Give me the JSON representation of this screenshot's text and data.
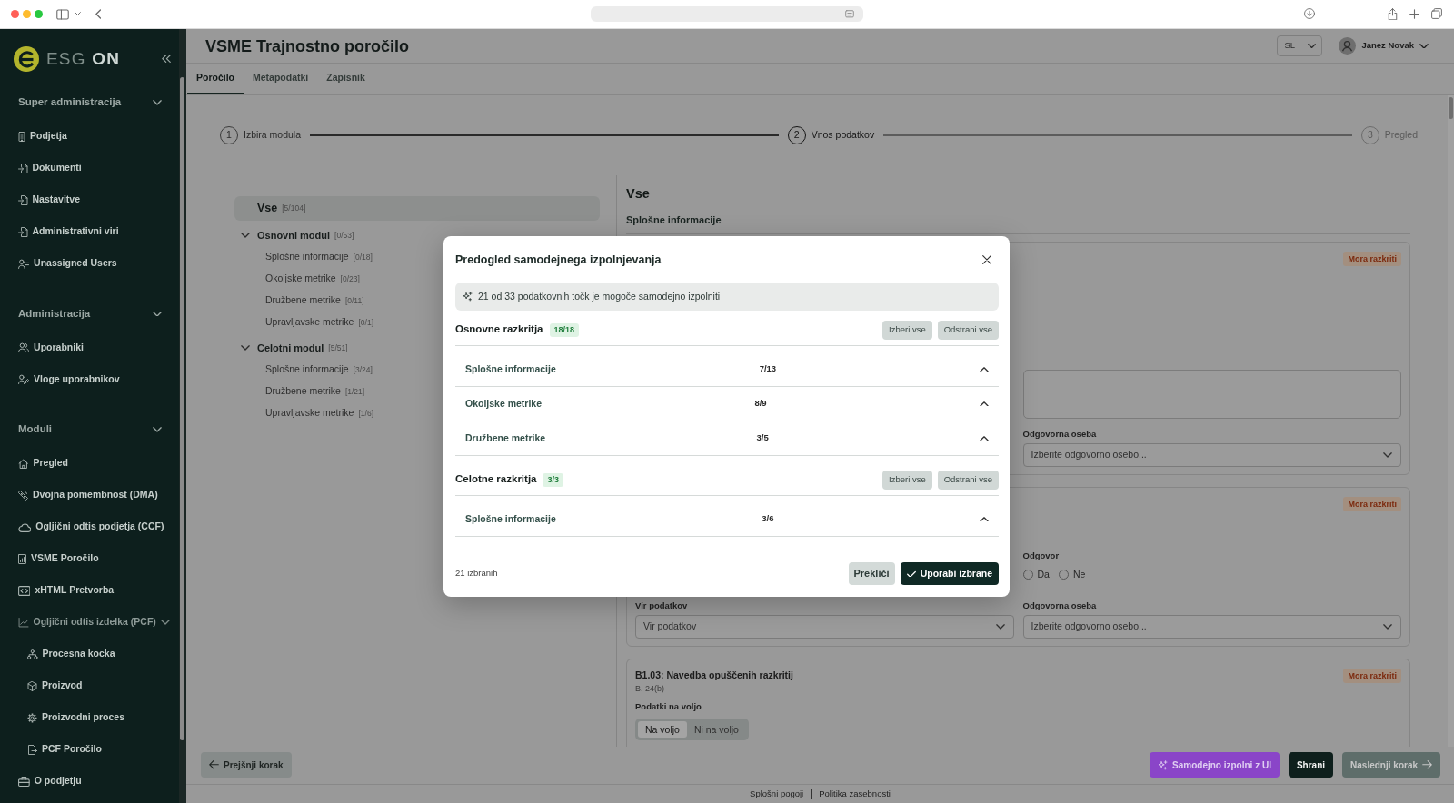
{
  "sidebar": {
    "logo": {
      "text": "ESG",
      "accent": "ON"
    },
    "sections": [
      {
        "title": "Super administracija",
        "expanded": true,
        "items": [
          {
            "label": "Podjetja"
          },
          {
            "label": "Dokumenti"
          },
          {
            "label": "Nastavitve"
          },
          {
            "label": "Administrativni viri"
          },
          {
            "label": "Unassigned Users"
          }
        ]
      },
      {
        "title": "Administracija",
        "expanded": true,
        "items": [
          {
            "label": "Uporabniki"
          },
          {
            "label": "Vloge uporabnikov"
          }
        ]
      },
      {
        "title": "Moduli",
        "expanded": true,
        "items": [
          {
            "label": "Pregled"
          },
          {
            "label": "Dvojna pomembnost (DMA)"
          },
          {
            "label": "Ogljični odtis podjetja (CCF)"
          },
          {
            "label": "VSME Poročilo"
          },
          {
            "label": "xHTML Pretvorba"
          },
          {
            "label": "Ogljični odtis izdelka (PCF)",
            "expanded": true,
            "children": [
              {
                "label": "Procesna kocka"
              },
              {
                "label": "Proizvod"
              },
              {
                "label": "Proizvodni proces"
              },
              {
                "label": "PCF Poročilo"
              }
            ]
          },
          {
            "label": "O podjetju"
          }
        ]
      }
    ]
  },
  "header": {
    "title": "VSME Trajnostno poročilo",
    "language": "SL",
    "user": "Janez Novak"
  },
  "tabs": [
    {
      "label": "Poročilo",
      "selected": true
    },
    {
      "label": "Metapodatki",
      "selected": false
    },
    {
      "label": "Zapisnik",
      "selected": false
    }
  ],
  "stepper": [
    {
      "number": "1",
      "label": "Izbira modula",
      "completed": true,
      "selected": false
    },
    {
      "number": "2",
      "label": "Vnos podatkov",
      "completed": false,
      "selected": true
    },
    {
      "number": "3",
      "label": "Pregled",
      "completed": false,
      "selected": false
    }
  ],
  "tree": [
    {
      "label": "Vse",
      "count": "[5/104]",
      "selected": true
    },
    {
      "label": "Osnovni modul",
      "count": "[0/53]",
      "selected": false,
      "expanded": true,
      "children": [
        {
          "label": "Splošne informacije",
          "count": "[0/18]",
          "selected": false
        },
        {
          "label": "Okoljske metrike",
          "count": "[0/23]",
          "selected": false
        },
        {
          "label": "Družbene metrike",
          "count": "[0/11]",
          "selected": false
        },
        {
          "label": "Upravljavske metrike",
          "count": "[0/1]",
          "selected": false
        }
      ]
    },
    {
      "label": "Celotni modul",
      "count": "[5/51]",
      "selected": false,
      "expanded": true,
      "children": [
        {
          "label": "Splošne informacije",
          "count": "[3/24]",
          "selected": false
        },
        {
          "label": "Družbene metrike",
          "count": "[1/21]",
          "selected": false
        },
        {
          "label": "Upravljavske metrike",
          "count": "[1/6]",
          "selected": false
        }
      ]
    }
  ],
  "content": {
    "title": "Vse",
    "section": "Splošne informacije",
    "cards": [
      {
        "kind": "text",
        "badge": "Mora razkriti",
        "responsible": {
          "label": "Odgovorna oseba",
          "placeholder": "Izberite odgovorno osebo..."
        }
      },
      {
        "kind": "choice",
        "badge": "Mora razkriti",
        "answer": {
          "label": "Odgovor",
          "options": [
            {
              "label": "Da",
              "selected": false
            },
            {
              "label": "Ne",
              "selected": false
            }
          ]
        },
        "source": {
          "label": "Vir podatkov",
          "placeholder": "Vir podatkov"
        },
        "responsible": {
          "label": "Odgovorna oseba",
          "placeholder": "Izberite odgovorno osebo..."
        }
      },
      {
        "kind": "availability",
        "badge": "Mora razkriti",
        "title": "B1.03: Navedba opuščenih razkritij",
        "reference": "B. 24(b)",
        "availability": {
          "label": "Podatki na voljo",
          "options": [
            {
              "label": "Na voljo",
              "selected": true
            },
            {
              "label": "Ni na voljo",
              "selected": false
            }
          ]
        }
      }
    ]
  },
  "actions": [
    {
      "label": "Prejšnji korak",
      "kind": "back",
      "disabled": false
    },
    {
      "label": "Samodejno izpolni z UI",
      "kind": "ai",
      "disabled": false
    },
    {
      "label": "Shrani",
      "kind": "save",
      "disabled": false
    },
    {
      "label": "Naslednji korak",
      "kind": "next",
      "disabled": true
    }
  ],
  "footer": {
    "links": [
      "Splošni pogoji",
      "Politika zasebnosti"
    ]
  },
  "dialog": {
    "title": "Predogled samodejnega izpolnjevanja",
    "summary": "21 od 33 podatkovnih točk je mogoče samodejno izpolniti",
    "sections": [
      {
        "title": "Osnovne razkritja",
        "count": "18/18",
        "buttons": [
          "Izberi vse",
          "Odstrani vse"
        ],
        "rows": [
          {
            "label": "Splošne informacije",
            "count": "7/13"
          },
          {
            "label": "Okoljske metrike",
            "count": "8/9"
          },
          {
            "label": "Družbene metrike",
            "count": "3/5"
          }
        ]
      },
      {
        "title": "Celotne razkritja",
        "count": "3/3",
        "buttons": [
          "Izberi vse",
          "Odstrani vse"
        ],
        "rows": [
          {
            "label": "Splošne informacije",
            "count": "3/6"
          }
        ]
      }
    ],
    "selection_summary": "21 izbranih",
    "buttons": [
      {
        "label": "Prekliči",
        "kind": "cancel"
      },
      {
        "label": "Uporabi izbrane",
        "kind": "apply"
      }
    ]
  }
}
